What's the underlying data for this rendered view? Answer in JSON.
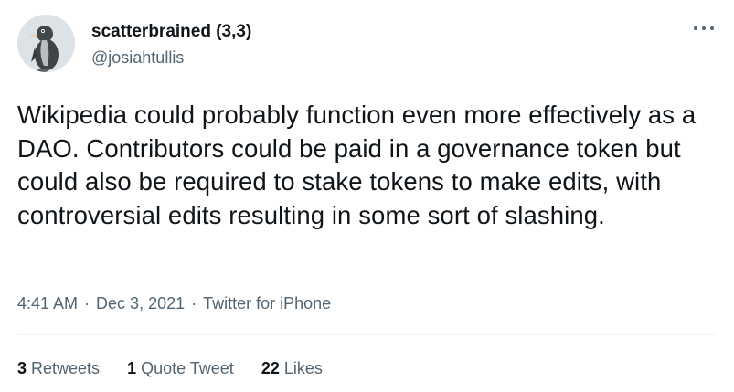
{
  "user": {
    "display_name": "scatterbrained (3,3)",
    "handle": "@josiahtullis",
    "avatar_icon": "penguin-avatar-icon"
  },
  "more_icon": "more-horizontal-icon",
  "tweet": {
    "text": "Wikipedia could probably function even more effectively as a DAO. Contributors could be paid in a governance token but could also be required to stake tokens to make edits, with controversial edits resulting in some sort of slashing."
  },
  "meta": {
    "time": "4:41 AM",
    "separator": "·",
    "date": "Dec 3, 2021",
    "source": "Twitter for iPhone"
  },
  "stats": {
    "retweets": {
      "count": "3",
      "label": "Retweets"
    },
    "quotes": {
      "count": "1",
      "label": "Quote Tweet"
    },
    "likes": {
      "count": "22",
      "label": "Likes"
    }
  },
  "colors": {
    "text": "#0f1419",
    "secondary": "#536471",
    "divider": "#eff3f4"
  }
}
